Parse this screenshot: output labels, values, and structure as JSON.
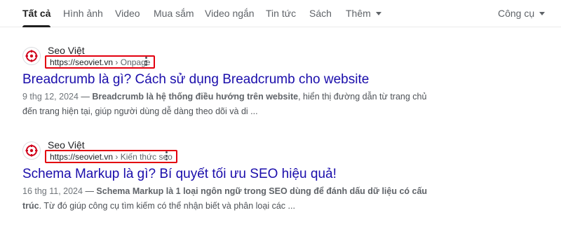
{
  "tabs": {
    "items": [
      "Tất cả",
      "Hình ảnh",
      "Video",
      "Mua sắm",
      "Video ngắn",
      "Tin tức",
      "Sách",
      "Thêm"
    ],
    "tools": "Công cụ"
  },
  "results": [
    {
      "site_name": "Seo Việt",
      "url_domain": "https://seoviet.vn",
      "url_sep": "›",
      "url_path": "Onpage",
      "title": "Breadcrumb là gì? Cách sử dụng Breadcrumb cho website",
      "date": "9 thg 12, 2024",
      "dash": " — ",
      "snippet_bold": "Breadcrumb là hệ thống điều hướng trên website",
      "snippet_line1_rest": ", hiển thị đường dẫn từ trang chủ",
      "snippet_line2": "đến trang hiện tại, giúp người dùng dễ dàng theo dõi và di ..."
    },
    {
      "site_name": "Seo Việt",
      "url_domain": "https://seoviet.vn",
      "url_sep": "›",
      "url_path": "Kiến thức seo",
      "title": "Schema Markup là gì? Bí quyết tối ưu SEO hiệu quả!",
      "date": "16 thg 11, 2024",
      "dash": " — ",
      "snippet_bold": "Schema Markup là 1 loại ngôn ngữ trong SEO dùng để đánh dấu dữ liệu có cấu",
      "snippet_bold2": "trúc",
      "snippet_line2_rest": ". Từ đó giúp công cụ tìm kiếm có thể nhận biết và phân loại các ..."
    }
  ],
  "colors": {
    "title_link": "#1a0dab",
    "highlight_box": "#e3000f",
    "favicon_red": "#d0021b"
  }
}
